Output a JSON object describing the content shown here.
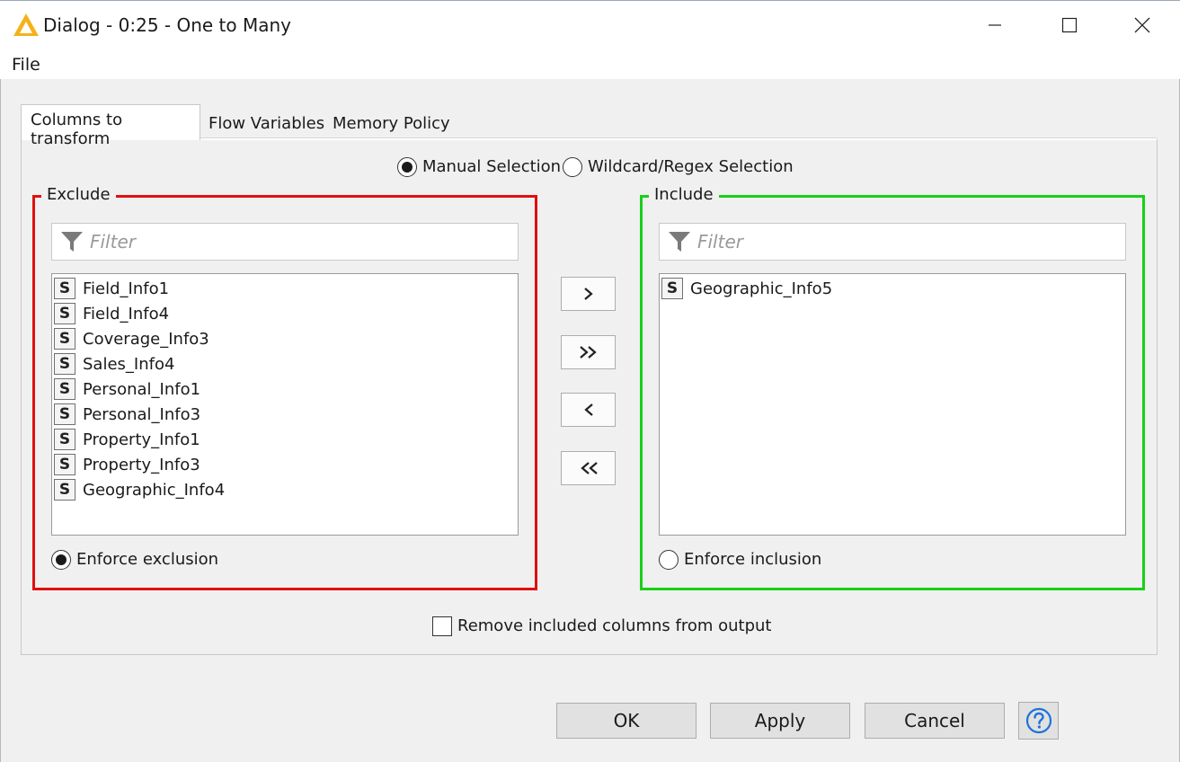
{
  "window": {
    "title": "Dialog - 0:25 - One to Many",
    "icon": "warning-triangle-icon",
    "controls": [
      "minimize-icon",
      "maximize-icon",
      "close-icon"
    ]
  },
  "menu": {
    "file": "File"
  },
  "tabs": [
    {
      "label": "Columns to transform",
      "active": true
    },
    {
      "label": "Flow Variables",
      "active": false
    },
    {
      "label": "Memory Policy",
      "active": false
    }
  ],
  "selection_mode": {
    "manual": "Manual Selection",
    "wildcard": "Wildcard/Regex Selection",
    "selected": "manual"
  },
  "exclude": {
    "title": "Exclude",
    "border_color": "#e01010",
    "filter_placeholder": "Filter",
    "type_badge": "S",
    "items": [
      "Field_Info1",
      "Field_Info4",
      "Coverage_Info3",
      "Sales_Info4",
      "Personal_Info1",
      "Personal_Info3",
      "Property_Info1",
      "Property_Info3",
      "Geographic_Info4"
    ],
    "enforce_label": "Enforce exclusion",
    "enforce_selected": true
  },
  "include": {
    "title": "Include",
    "border_color": "#18d018",
    "filter_placeholder": "Filter",
    "type_badge": "S",
    "items": [
      "Geographic_Info5"
    ],
    "enforce_label": "Enforce inclusion",
    "enforce_selected": false
  },
  "move_buttons": {
    "add": ">",
    "add_all": "»",
    "remove": "<",
    "remove_all": "«"
  },
  "remove_included": {
    "label": "Remove included columns from output",
    "checked": false
  },
  "buttons": {
    "ok": "OK",
    "apply": "Apply",
    "cancel": "Cancel",
    "help_icon": "help-icon"
  }
}
